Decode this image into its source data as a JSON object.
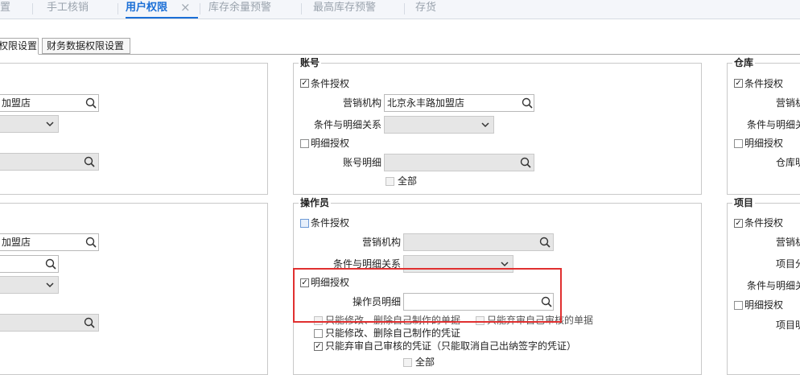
{
  "tabs": [
    {
      "label": "置",
      "active": false
    },
    {
      "label": "手工核销",
      "active": false
    },
    {
      "label": "用户权限",
      "active": true
    },
    {
      "label": "库存余量预警",
      "active": false
    },
    {
      "label": "最高库存预警",
      "active": false
    },
    {
      "label": "存货",
      "active": false
    }
  ],
  "tab_close_glyph": "×",
  "subtabs": [
    {
      "label": "权限设置",
      "active": true
    },
    {
      "label": "财务数据权限设置",
      "active": false
    }
  ],
  "left_top": {
    "org_value": "加盟店"
  },
  "left_bottom": {
    "org_value": "加盟店"
  },
  "account_group": {
    "title": "账号",
    "cond_auth": {
      "label": "条件授权",
      "checked": true
    },
    "org_label": "营销机构",
    "org_value": "北京永丰路加盟店",
    "relation_label": "条件与明细关系",
    "detail_auth": {
      "label": "明细授权",
      "checked": false
    },
    "detail_label": "账号明细",
    "all": {
      "label": "全部",
      "checked": false
    }
  },
  "operator_group": {
    "title": "操作员",
    "cond_auth": {
      "label": "条件授权",
      "checked": false
    },
    "org_label": "营销机构",
    "relation_label": "条件与明细关系",
    "detail_auth": {
      "label": "明细授权",
      "checked": true
    },
    "detail_label": "操作员明细",
    "opt_modify_docs": {
      "label": "只能修改、删除自己制作的单据",
      "checked": false
    },
    "opt_abandon_docs": {
      "label": "只能弃审自己审核的单据",
      "checked": false
    },
    "opt_modify_vouchers": {
      "label": "只能修改、删除自己制作的凭证",
      "checked": false
    },
    "opt_abandon_vouchers": {
      "label": "只能弃审自己审核的凭证（只能取消自己出纳签字的凭证）",
      "checked": true
    },
    "all": {
      "label": "全部",
      "checked": false
    }
  },
  "warehouse_group": {
    "title": "仓库",
    "cond_auth": {
      "label": "条件授权",
      "checked": true
    },
    "org_label": "营销机",
    "relation_label": "条件与明细关",
    "detail_auth": {
      "label": "明细授权",
      "checked": false
    },
    "detail_label": "仓库明"
  },
  "project_group": {
    "title": "项目",
    "cond_auth": {
      "label": "条件授权",
      "checked": true
    },
    "org_label": "营销机",
    "class_label": "项目分",
    "relation_label": "条件与明细关",
    "detail_auth": {
      "label": "明细授权",
      "checked": false
    },
    "detail_label": "项目明"
  },
  "colors": {
    "accent": "#1b6fd6",
    "highlight_border": "#e03030",
    "disabled_field": "#e6e6e6"
  },
  "icons": {
    "lookup": "search-lookup-icon",
    "dropdown": "chevron-down-icon",
    "close": "close-icon"
  }
}
